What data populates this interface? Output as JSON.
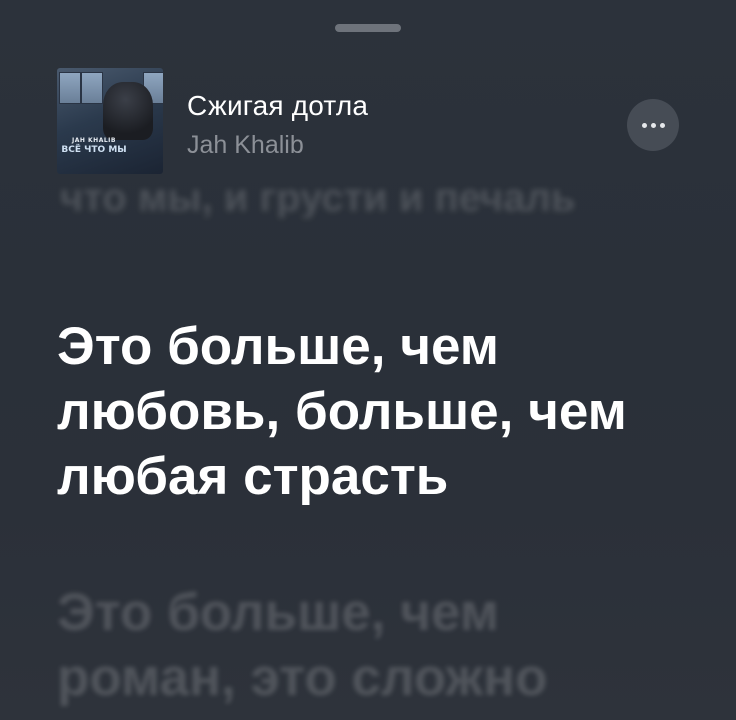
{
  "track": {
    "title": "Сжигая дотла",
    "artist": "Jah Khalib"
  },
  "cover": {
    "artist_text": "JAH KHALIB",
    "album_text": "ВСЁ ЧТО МЫ"
  },
  "lyrics": {
    "previous_faded": "что мы, и грусти и печаль",
    "current": [
      "Это больше, чем",
      "любовь, больше, чем",
      "любая страсть"
    ],
    "next": [
      "Это больше, чем",
      "роман, это сложно"
    ]
  },
  "icons": {
    "more": "more-options-icon",
    "grabber": "sheet-grabber"
  },
  "colors": {
    "background": "#2b3039",
    "primary_text": "#ffffff",
    "secondary_text": "#8c9097",
    "button_bg": "#464c55"
  }
}
